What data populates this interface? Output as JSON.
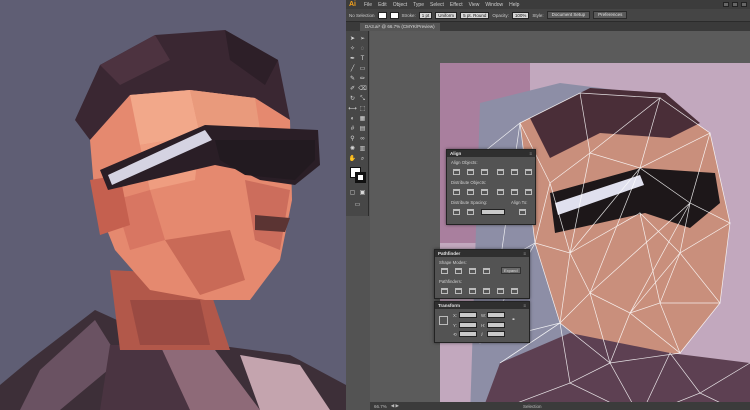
{
  "app": {
    "logo": "Ai"
  },
  "menu": [
    "File",
    "Edit",
    "Object",
    "Type",
    "Select",
    "Effect",
    "View",
    "Window",
    "Help"
  ],
  "control_bar": {
    "selection": "No Selection",
    "stroke_label": "Stroke:",
    "stroke_value": "1 pt",
    "profile": "Uniform",
    "brush": "5 pt. Round",
    "opacity_label": "Opacity:",
    "opacity_value": "100%",
    "style_label": "Style:",
    "doc_setup": "Document Setup",
    "preferences": "Preferences"
  },
  "document_tab": "DA3.ai* @ 66.7% (CMYK/Preview)",
  "panels": {
    "align": {
      "tab": "Align",
      "align_objects": "Align Objects:",
      "distribute_objects": "Distribute Objects:",
      "distribute_spacing": "Distribute Spacing:",
      "align_to": "Align To:"
    },
    "pathfinder": {
      "tab": "Pathfinder",
      "shape_modes": "Shape Modes:",
      "pathfinders": "Pathfinders:",
      "expand": "Expand"
    },
    "transform": {
      "tab": "Transform",
      "x_label": "X:",
      "y_label": "Y:",
      "w_label": "W:",
      "h_label": "H:"
    }
  },
  "status_bar": {
    "zoom": "66.7%",
    "tool": "Selection"
  },
  "colors": {
    "accent": "#f4a21c",
    "background": "#5f5e74",
    "ui_dark": "#3c3c3c",
    "panel": "#535353"
  }
}
